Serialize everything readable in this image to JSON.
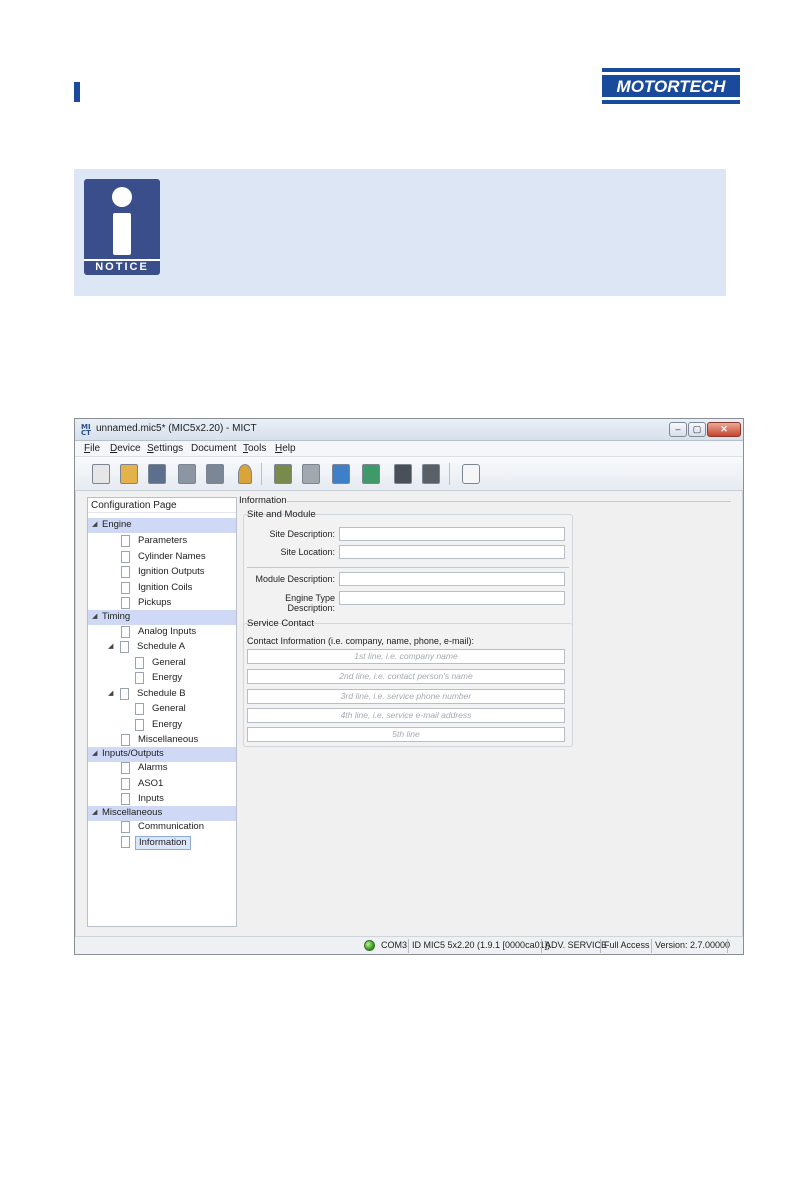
{
  "brand": {
    "logo_text": "MOTORTECH",
    "accent": "#1a4a9c"
  },
  "notice": {
    "label": "NOTICE",
    "background": "#dde6f4",
    "icon_color": "#3b4e8c"
  },
  "window": {
    "app_icon": "MI CT",
    "title": "unnamed.mic5* (MIC5x2.20) - MICT",
    "controls": {
      "minimize": "–",
      "maximize": "▢",
      "close": "✕"
    }
  },
  "menu": [
    {
      "label": "File",
      "underline": "F"
    },
    {
      "label": "Device",
      "underline": "D"
    },
    {
      "label": "Settings",
      "underline": "S"
    },
    {
      "label": "Document",
      "underline": ""
    },
    {
      "label": "Tools",
      "underline": "T"
    },
    {
      "label": "Help",
      "underline": "H"
    }
  ],
  "toolbar": [
    {
      "icon": "new-document-icon",
      "color": "#e6e6e6"
    },
    {
      "icon": "open-folder-icon",
      "color": "#e3b24b"
    },
    {
      "icon": "save-icon",
      "color": "#5c6f8c"
    },
    {
      "icon": "print-icon",
      "color": "#8c96a3"
    },
    {
      "icon": "print-preview-icon",
      "color": "#7b8796"
    },
    {
      "icon": "key-icon",
      "color": "#d9a53a"
    },
    {
      "icon": "device-online-icon",
      "color": "#7a8a4c"
    },
    {
      "icon": "device-offline-icon",
      "color": "#a2a8b0"
    },
    {
      "icon": "read-from-device-icon",
      "color": "#3f7fc7"
    },
    {
      "icon": "write-to-device-icon",
      "color": "#3f9a6a"
    },
    {
      "icon": "monitor-icon",
      "color": "#4a5058"
    },
    {
      "icon": "logbook-icon",
      "color": "#5a6068"
    },
    {
      "icon": "gauge-icon",
      "color": "#c8ced6"
    }
  ],
  "tree": {
    "header": "Configuration Page",
    "items": [
      {
        "label": "Engine",
        "level": 0,
        "type": "category",
        "expanded": true
      },
      {
        "label": "Parameters",
        "level": 2,
        "type": "page"
      },
      {
        "label": "Cylinder Names",
        "level": 2,
        "type": "page"
      },
      {
        "label": "Ignition Outputs",
        "level": 2,
        "type": "page"
      },
      {
        "label": "Ignition Coils",
        "level": 2,
        "type": "page"
      },
      {
        "label": "Pickups",
        "level": 2,
        "type": "page"
      },
      {
        "label": "Timing",
        "level": 0,
        "type": "category",
        "expanded": true
      },
      {
        "label": "Analog Inputs",
        "level": 2,
        "type": "page"
      },
      {
        "label": "Schedule A",
        "level": 1,
        "type": "folder",
        "expanded": true
      },
      {
        "label": "General",
        "level": 3,
        "type": "page"
      },
      {
        "label": "Energy",
        "level": 3,
        "type": "page"
      },
      {
        "label": "Schedule B",
        "level": 1,
        "type": "folder",
        "expanded": true
      },
      {
        "label": "General",
        "level": 3,
        "type": "page"
      },
      {
        "label": "Energy",
        "level": 3,
        "type": "page"
      },
      {
        "label": "Miscellaneous",
        "level": 2,
        "type": "page"
      },
      {
        "label": "Inputs/Outputs",
        "level": 0,
        "type": "category",
        "expanded": true
      },
      {
        "label": "Alarms",
        "level": 2,
        "type": "page"
      },
      {
        "label": "ASO1",
        "level": 2,
        "type": "page"
      },
      {
        "label": "Inputs",
        "level": 2,
        "type": "page"
      },
      {
        "label": "Miscellaneous",
        "level": 0,
        "type": "category",
        "expanded": true
      },
      {
        "label": "Communication",
        "level": 2,
        "type": "page"
      },
      {
        "label": "Information",
        "level": 2,
        "type": "page",
        "selected": true
      }
    ]
  },
  "information": {
    "title": "Information",
    "site_module": {
      "title": "Site and Module",
      "fields": [
        {
          "label": "Site Description:",
          "value": ""
        },
        {
          "label": "Site Location:",
          "value": ""
        },
        {
          "label": "Module Description:",
          "value": ""
        },
        {
          "label": "Engine Type Description:",
          "value": ""
        }
      ]
    },
    "service_contact": {
      "title": "Service Contact",
      "hint": "Contact Information (i.e. company, name, phone, e-mail):",
      "lines": [
        {
          "placeholder": "1st line, i.e. company name",
          "value": ""
        },
        {
          "placeholder": "2nd line, i.e. contact person's name",
          "value": ""
        },
        {
          "placeholder": "3rd line, i.e. service phone number",
          "value": ""
        },
        {
          "placeholder": "4th line, i.e. service e-mail address",
          "value": ""
        },
        {
          "placeholder": "5th line",
          "value": ""
        }
      ]
    }
  },
  "status": {
    "led_color": "#3aa21c",
    "port": "COM3",
    "device_id": "ID MIC5 5x2.20 (1.9.1 [0000ca01])",
    "mode": "ADV. SERVICE",
    "access": "Full Access",
    "version": "Version: 2.7.00000"
  }
}
